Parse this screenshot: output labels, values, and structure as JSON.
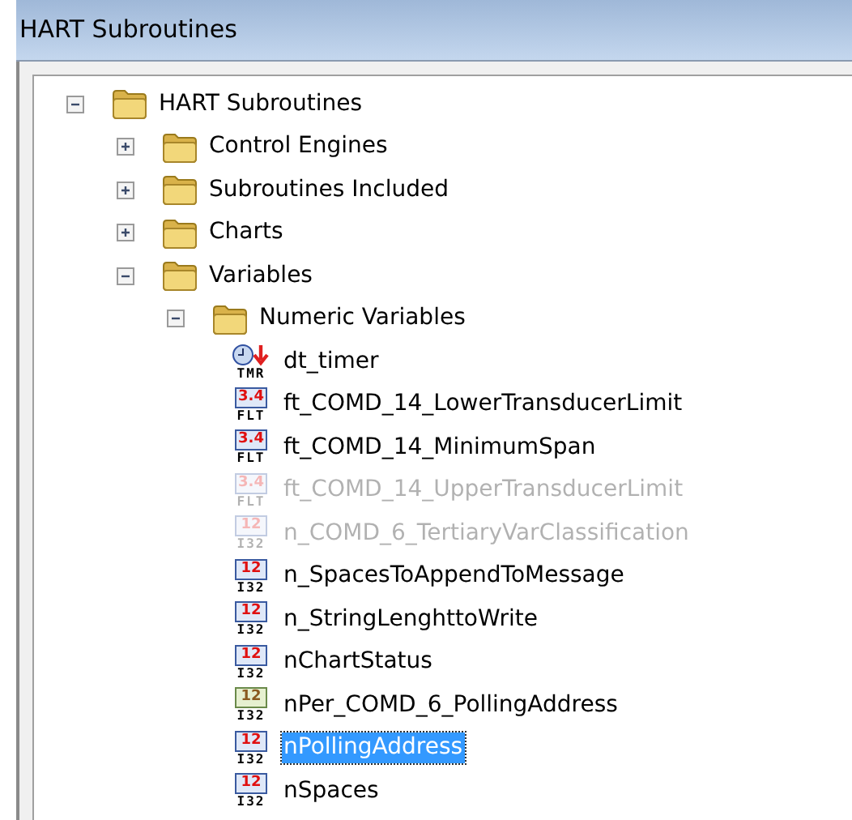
{
  "window": {
    "title": "HART Subroutines"
  },
  "tree": [
    {
      "kind": "folder",
      "label": "HART Subroutines",
      "expanded": true,
      "children": [
        {
          "kind": "folder",
          "label": "Control Engines",
          "expanded": false
        },
        {
          "kind": "folder",
          "label": "Subroutines Included",
          "expanded": false
        },
        {
          "kind": "folder",
          "label": "Charts",
          "expanded": false
        },
        {
          "kind": "folder",
          "label": "Variables",
          "expanded": true,
          "children": [
            {
              "kind": "folder",
              "label": "Numeric Variables",
              "expanded": true,
              "children": [
                {
                  "kind": "timer",
                  "label": "dt_timer",
                  "type_label": "TMR",
                  "selected": false,
                  "faded": false
                },
                {
                  "kind": "float",
                  "label": "ft_COMD_14_LowerTransducerLimit",
                  "badge": "3.4",
                  "type_label": "FLT",
                  "selected": false,
                  "faded": false
                },
                {
                  "kind": "float",
                  "label": "ft_COMD_14_MinimumSpan",
                  "badge": "3.4",
                  "type_label": "FLT",
                  "selected": false,
                  "faded": false
                },
                {
                  "kind": "float",
                  "label": "ft_COMD_14_UpperTransducerLimit",
                  "badge": "3.4",
                  "type_label": "FLT",
                  "selected": false,
                  "faded": true
                },
                {
                  "kind": "integer",
                  "label": "n_COMD_6_TertiaryVarClassification",
                  "badge": "12",
                  "type_label": "I32",
                  "persistent": false,
                  "selected": false,
                  "faded": true
                },
                {
                  "kind": "integer",
                  "label": "n_SpacesToAppendToMessage",
                  "badge": "12",
                  "type_label": "I32",
                  "persistent": false,
                  "selected": false,
                  "faded": false
                },
                {
                  "kind": "integer",
                  "label": "n_StringLenghttoWrite",
                  "badge": "12",
                  "type_label": "I32",
                  "persistent": false,
                  "selected": false,
                  "faded": false
                },
                {
                  "kind": "integer",
                  "label": "nChartStatus",
                  "badge": "12",
                  "type_label": "I32",
                  "persistent": false,
                  "selected": false,
                  "faded": false
                },
                {
                  "kind": "integer",
                  "label": "nPer_COMD_6_PollingAddress",
                  "badge": "12",
                  "type_label": "I32",
                  "persistent": true,
                  "selected": false,
                  "faded": false
                },
                {
                  "kind": "integer",
                  "label": "nPollingAddress",
                  "badge": "12",
                  "type_label": "I32",
                  "persistent": false,
                  "selected": true,
                  "faded": false
                },
                {
                  "kind": "integer",
                  "label": "nSpaces",
                  "badge": "12",
                  "type_label": "I32",
                  "persistent": false,
                  "selected": false,
                  "faded": false
                }
              ]
            }
          ]
        }
      ]
    }
  ]
}
